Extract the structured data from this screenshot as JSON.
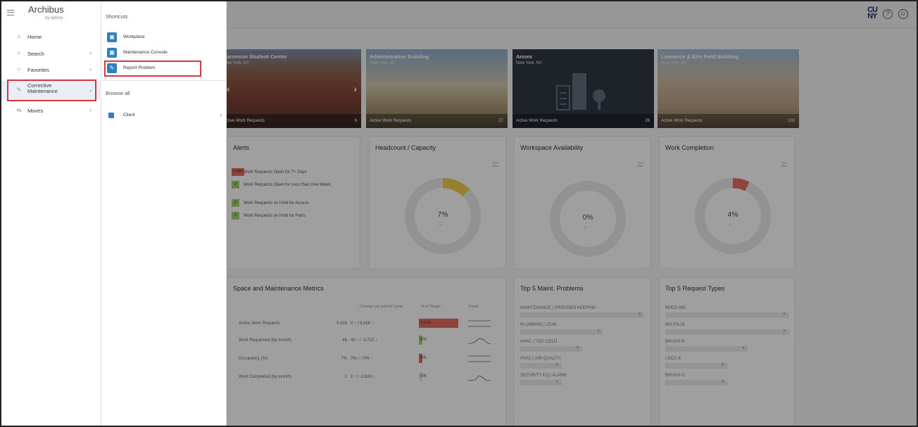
{
  "app": {
    "logo": "Archibus",
    "logo_sub": "by eptura",
    "brand": "CUNY"
  },
  "nav": {
    "items": [
      {
        "label": "Home",
        "icon": "home-icon"
      },
      {
        "label": "Search",
        "icon": "search-icon",
        "chevron": "›"
      },
      {
        "label": "Favorites",
        "icon": "star-icon",
        "chevron": "›"
      },
      {
        "label": "Corrective Maintenance",
        "icon": "wrench-icon",
        "chevron": "‹",
        "active": true
      },
      {
        "label": "Moves",
        "icon": "moves-icon",
        "chevron": "›"
      }
    ]
  },
  "flyout": {
    "shortcuts_heading": "Shortcuts",
    "shortcuts": [
      {
        "label": "Workplace",
        "icon": "workplace-icon"
      },
      {
        "label": "Maintenance Console",
        "icon": "grid-icon"
      },
      {
        "label": "Report Problem",
        "icon": "report-icon"
      }
    ],
    "browse_heading": "Browse all",
    "browse_items": [
      {
        "label": "Client",
        "chevron": "›"
      }
    ]
  },
  "buildings": [
    {
      "name": "Aaronson Student Center",
      "city": "New York, NY",
      "footer_label": "Active Work Requests",
      "count": "6"
    },
    {
      "name": "Administrative Building",
      "city": "New York, NY",
      "footer_label": "Active Work Requests",
      "count": "27"
    },
    {
      "name": "Annex",
      "city": "New York, NY",
      "footer_label": "Active Work Requests",
      "count": "26"
    },
    {
      "name": "Lawrence & Eris Field Building",
      "city": "New York, NY",
      "footer_label": "Active Work Requests",
      "count": "103"
    }
  ],
  "alerts": {
    "title": "Alerts",
    "items": [
      {
        "badge": "9,885",
        "text": "Work Requests Open for 7+ Days",
        "color": "#e06a5e"
      },
      {
        "badge": "3",
        "text": "Work Requests Open for Less than One Week",
        "color": "#9fcf6b"
      },
      {
        "badge": "0",
        "text": "Work Requests on Hold for Access",
        "color": "#9fcf6b"
      },
      {
        "badge": "0",
        "text": "Work Requests on Hold for Parts",
        "color": "#9fcf6b"
      }
    ]
  },
  "kpis": [
    {
      "title": "Headcount / Capacity",
      "value": "7%",
      "fraction": 0.07,
      "color": "#e9c84a"
    },
    {
      "title": "Workspace Availability",
      "value": "0%",
      "fraction": 0.0,
      "color": "#e5e5e5"
    },
    {
      "title": "Work Completion",
      "value": "4%",
      "fraction": 0.04,
      "color": "#e06a5e"
    }
  ],
  "metrics": {
    "title": "Space and Maintenance Metrics",
    "headers": [
      "Change per period / year",
      "% of Target",
      "Trend"
    ],
    "rows": [
      {
        "label": "Active Work Requests",
        "value": "9,418",
        "change": "0 ↑ / 9,418 ↑",
        "target": "9,418",
        "target_fill": 1.0,
        "target_color": "#e06a5e"
      },
      {
        "label": "Work Requested (by month)",
        "value": "46",
        "change": "40 ↑ / -3,722 ↓",
        "target": "9%",
        "target_fill": 0.09,
        "target_color": "#9fcf6b"
      },
      {
        "label": "Occupancy (%)",
        "value": "7%",
        "change": "0% ↑ / 0% ↑",
        "target": "8%",
        "target_fill": 0.08,
        "target_color": "#e06a5e"
      },
      {
        "label": "Work Completed (by month)",
        "value": "2",
        "change": "2 ↑ / -2,929 ↓",
        "target": "0%",
        "target_fill": 0.0,
        "target_color": "#e5e5e5"
      }
    ]
  },
  "top_problems": {
    "title": "Top 5 Maint. Problems",
    "items": [
      {
        "label": "MAINTENANCE | GROUNDS KEEPING",
        "value": 6
      },
      {
        "label": "PLUMBING | LEAK",
        "value": 4
      },
      {
        "label": "HVAC | TOO COLD",
        "value": 3
      },
      {
        "label": "HVAC | AIR QUALITY",
        "value": 2
      },
      {
        "label": "SECURITY EQ | ALARM",
        "value": 2
      }
    ]
  },
  "top_requests": {
    "title": "Top 5 Request Types",
    "items": [
      {
        "label": "BMCC-MC",
        "value": 6
      },
      {
        "label": "BKLYN-25",
        "value": 6
      },
      {
        "label": "BRUCH-B",
        "value": 4
      },
      {
        "label": "LGCC-E",
        "value": 3
      },
      {
        "label": "BRUCH-O",
        "value": 3
      }
    ]
  }
}
